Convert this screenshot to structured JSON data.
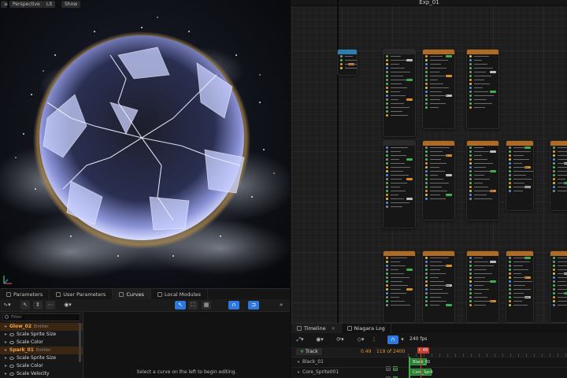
{
  "viewport": {
    "buttons": [
      "Perspective",
      "Lit",
      "Show"
    ]
  },
  "left_panel": {
    "tabs": [
      {
        "label": "Parameters"
      },
      {
        "label": "User Parameters"
      },
      {
        "label": "Curves"
      },
      {
        "label": "Local Modules"
      }
    ],
    "filter_placeholder": "Filter",
    "rows": [
      {
        "label": "Glow_02",
        "sub": "Emitter",
        "kind": "emitter"
      },
      {
        "label": "Scale Sprite Size",
        "kind": "param"
      },
      {
        "label": "Scale Color",
        "kind": "param"
      },
      {
        "label": "Spark_01",
        "sub": "Emitter",
        "kind": "emitter"
      },
      {
        "label": "Scale Sprite Size",
        "kind": "param"
      },
      {
        "label": "Scale Color",
        "kind": "param"
      },
      {
        "label": "Scale Velocity",
        "kind": "param"
      }
    ],
    "curve_message": "Select a curve on the left to begin editing."
  },
  "graph": {
    "title": "Exp_01"
  },
  "timeline": {
    "tabs": [
      {
        "label": "Timeline"
      },
      {
        "label": "Niagara Log"
      }
    ],
    "fps": "240 fps",
    "track_button": "Track",
    "time_current": "0.49",
    "time_total": "119 of 2400",
    "playhead_label": "0.49",
    "rows": [
      {
        "name": "Black_01",
        "bar": "Black_01"
      },
      {
        "name": "Core_Sprite001",
        "bar": "Core_Sprit"
      }
    ]
  },
  "colors": {
    "accent_blue": "#2e78e0",
    "emitter_orange": "#f0a64a",
    "track_green": "#2b7b32",
    "playhead_red": "#c43b2d"
  },
  "icons": {
    "viewport_menu": "hamburger-icon",
    "curve_tools": [
      "select-arrow-icon",
      "frame-icon",
      "magnet-icon",
      "snap-icon",
      "expand-icon"
    ]
  }
}
